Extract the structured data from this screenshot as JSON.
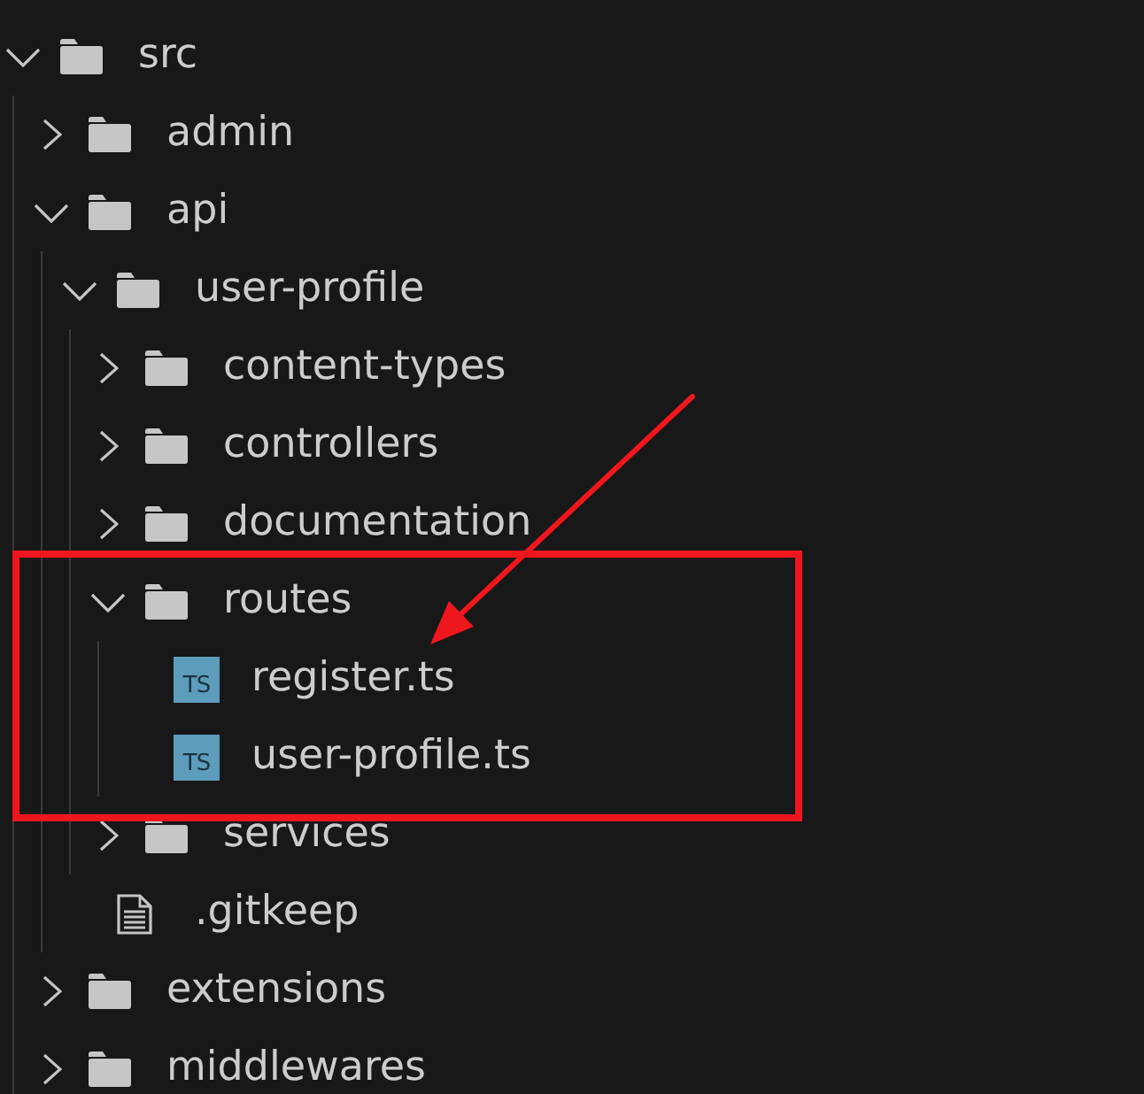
{
  "explorer": {
    "tree": [
      {
        "name": "src",
        "kind": "folder",
        "expanded": true,
        "children": [
          {
            "name": "admin",
            "kind": "folder",
            "expanded": false
          },
          {
            "name": "api",
            "kind": "folder",
            "expanded": true,
            "children": [
              {
                "name": "user-profile",
                "kind": "folder",
                "expanded": true,
                "children": [
                  {
                    "name": "content-types",
                    "kind": "folder",
                    "expanded": false
                  },
                  {
                    "name": "controllers",
                    "kind": "folder",
                    "expanded": false
                  },
                  {
                    "name": "documentation",
                    "kind": "folder",
                    "expanded": false
                  },
                  {
                    "name": "routes",
                    "kind": "folder",
                    "expanded": true,
                    "children": [
                      {
                        "name": "register.ts",
                        "kind": "ts-file",
                        "badge": "TS"
                      },
                      {
                        "name": "user-profile.ts",
                        "kind": "ts-file",
                        "badge": "TS"
                      }
                    ]
                  },
                  {
                    "name": "services",
                    "kind": "folder",
                    "expanded": false
                  }
                ]
              },
              {
                "name": ".gitkeep",
                "kind": "file"
              }
            ]
          },
          {
            "name": "extensions",
            "kind": "folder",
            "expanded": false
          },
          {
            "name": "middlewares",
            "kind": "folder",
            "expanded": false
          }
        ]
      }
    ]
  }
}
